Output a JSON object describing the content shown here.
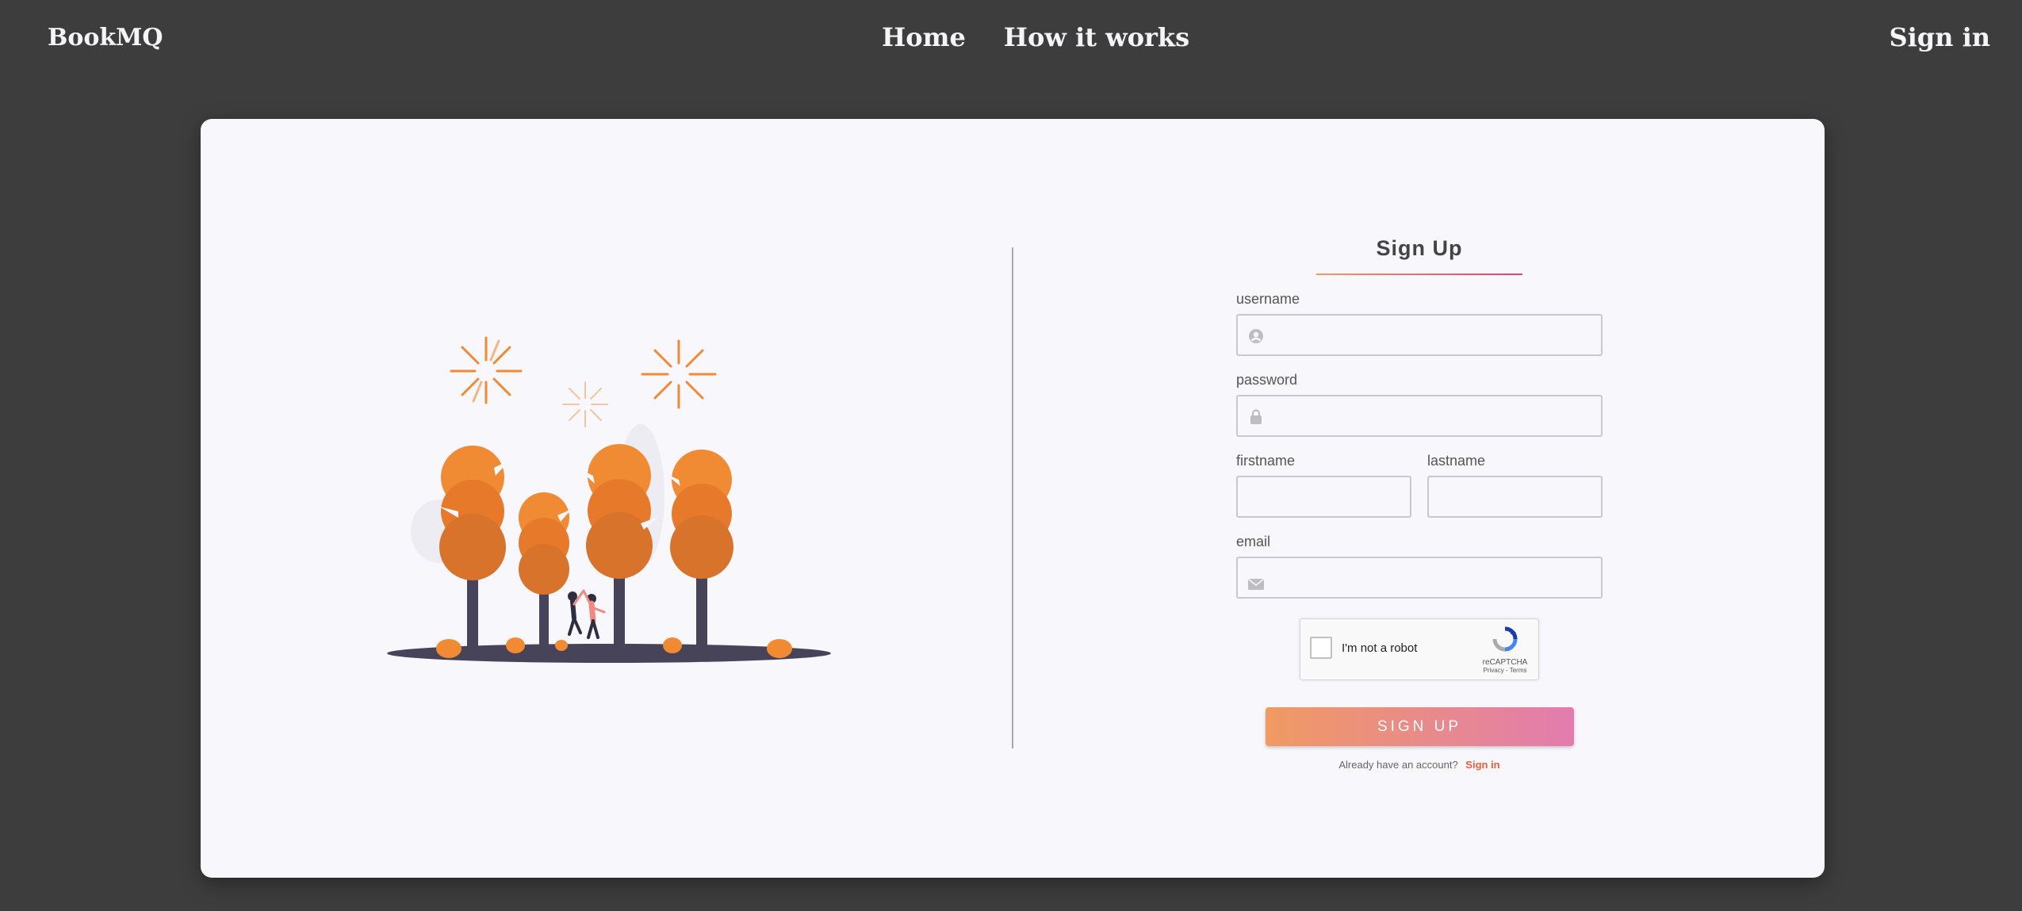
{
  "nav": {
    "brand": "BookMQ",
    "links": [
      "Home",
      "How it works"
    ],
    "signin": "Sign in"
  },
  "form": {
    "title": "Sign Up",
    "username_label": "username",
    "password_label": "password",
    "firstname_label": "firstname",
    "lastname_label": "lastname",
    "email_label": "email",
    "username_value": "",
    "password_value": "",
    "firstname_value": "",
    "lastname_value": "",
    "email_value": ""
  },
  "captcha": {
    "label": "I'm not a robot",
    "brand": "reCAPTCHA",
    "privacy": "Privacy - Terms"
  },
  "signup_button": "SIGN UP",
  "footer": {
    "question": "Already have an account?",
    "link": "Sign in"
  },
  "colors": {
    "background": "#3d3d3d",
    "card": "#f7f7fc",
    "accent_orange": "#f08a33",
    "button_gradient_start": "#f09a63",
    "button_gradient_end": "#e27caf",
    "link": "#e8613a"
  }
}
